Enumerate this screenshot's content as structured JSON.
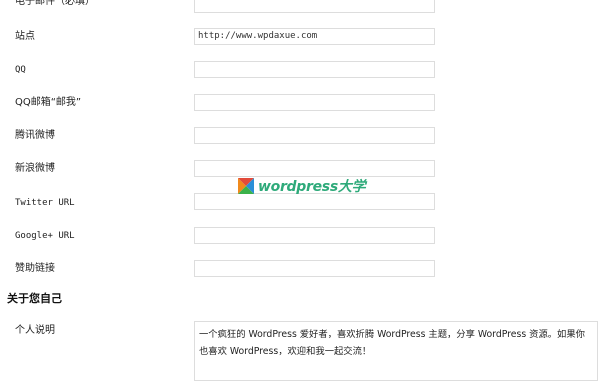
{
  "form": {
    "fields": [
      {
        "label": "电子邮件（必填）",
        "value": "",
        "cjk": true
      },
      {
        "label": "站点",
        "value": "http://www.wpdaxue.com",
        "cjk": true
      },
      {
        "label": "QQ",
        "value": "",
        "cjk": false
      },
      {
        "label": "QQ邮箱“邮我”",
        "value": "",
        "cjk": true
      },
      {
        "label": "腾讯微博",
        "value": "",
        "cjk": true
      },
      {
        "label": "新浪微博",
        "value": "",
        "cjk": true
      },
      {
        "label": "Twitter URL",
        "value": "",
        "cjk": false
      },
      {
        "label": "Google+ URL",
        "value": "",
        "cjk": false
      },
      {
        "label": "赞助链接",
        "value": "",
        "cjk": true
      }
    ],
    "about_section_title": "关于您自己",
    "bio": {
      "label": "个人说明",
      "value": "一个疯狂的 WordPress 爱好者，喜欢折腾 WordPress 主题，分享 WordPress 资源。如果你也喜欢 WordPress，欢迎和我一起交流！"
    }
  },
  "watermark": {
    "text": "wordpress大学",
    "colors": {
      "orange": "#f08a1c",
      "green": "#3bb24a",
      "blue": "#2a8fd8",
      "red": "#e24a3a"
    }
  }
}
